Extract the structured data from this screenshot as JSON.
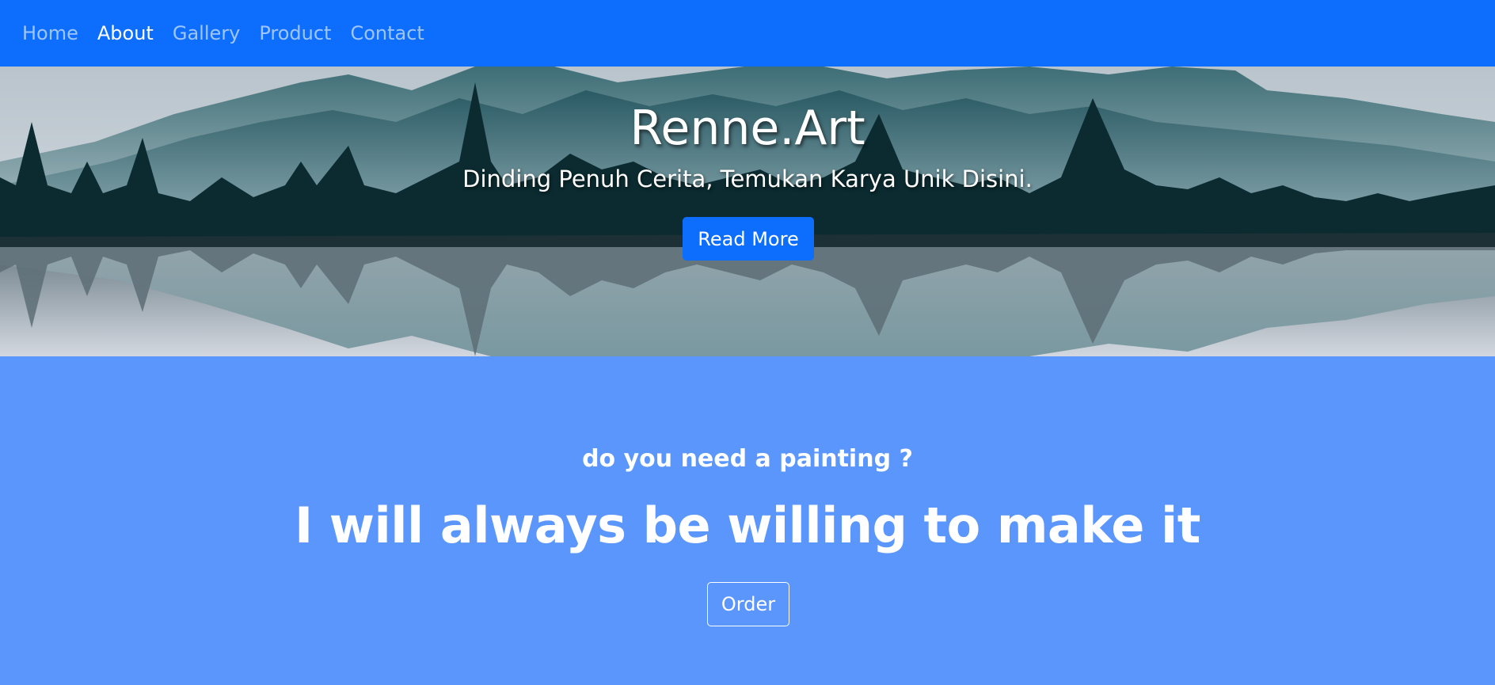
{
  "nav": {
    "items": [
      {
        "label": "Home",
        "active": false
      },
      {
        "label": "About",
        "active": true
      },
      {
        "label": "Gallery",
        "active": false
      },
      {
        "label": "Product",
        "active": false
      },
      {
        "label": "Contact",
        "active": false
      }
    ]
  },
  "hero": {
    "title": "Renne.Art",
    "subtitle": "Dinding Penuh Cerita, Temukan Karya Unik Disini.",
    "button_label": "Read More"
  },
  "about": {
    "question": "do you need a painting ?",
    "headline": "I will always be willing to make it",
    "button_label": "Order"
  },
  "colors": {
    "navbar": "#0d6efd",
    "primary_button": "#0d6efd",
    "about_background": "#5b96fd"
  }
}
